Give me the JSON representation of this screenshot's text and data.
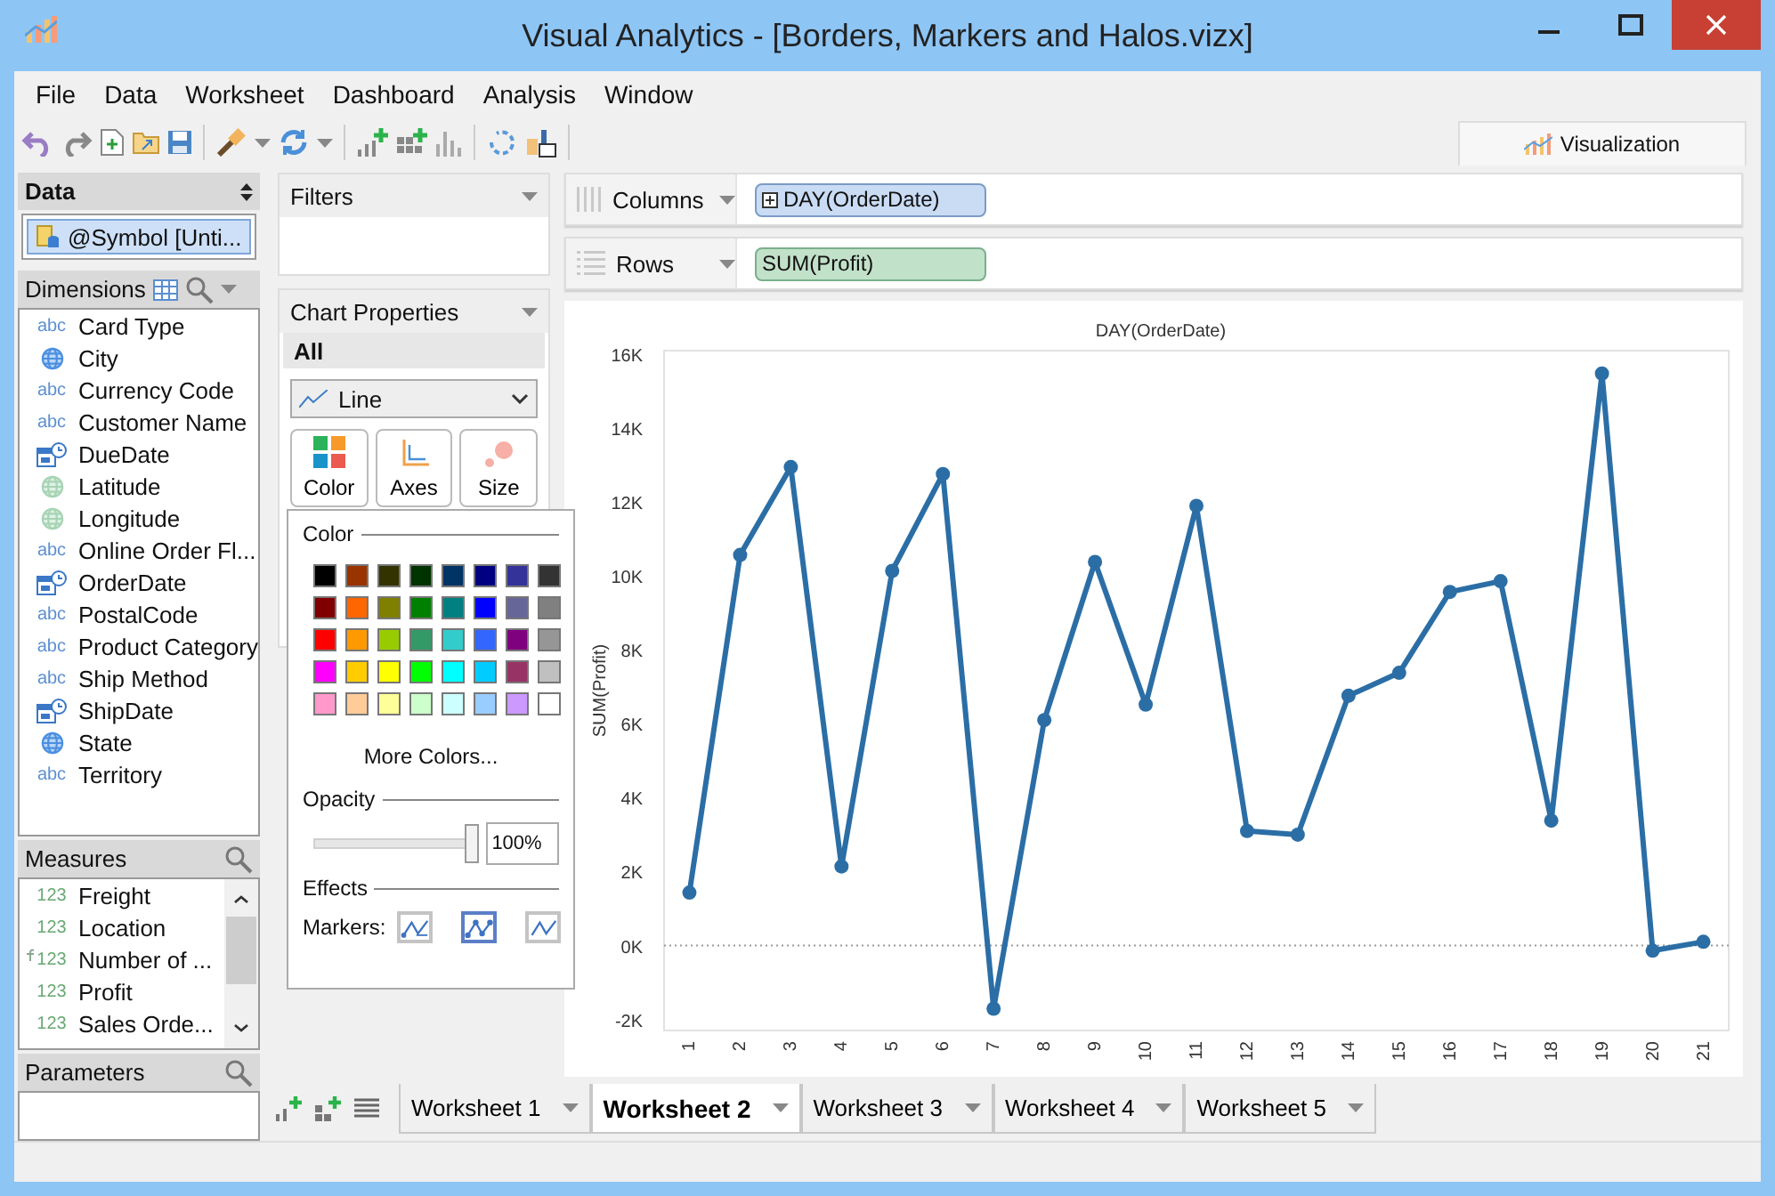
{
  "window": {
    "title": "Visual Analytics - [Borders, Markers and Halos.vizx]"
  },
  "menu": [
    "File",
    "Data",
    "Worksheet",
    "Dashboard",
    "Analysis",
    "Window"
  ],
  "toolbar_tab": {
    "label": "Visualization"
  },
  "data_pane": {
    "title": "Data",
    "source": "@Symbol [Unti..."
  },
  "dimensions": {
    "title": "Dimensions",
    "items": [
      {
        "kind": "string",
        "badge": "abc",
        "name": "Card Type"
      },
      {
        "kind": "geo",
        "name": "City"
      },
      {
        "kind": "string",
        "badge": "abc",
        "name": "Currency Code"
      },
      {
        "kind": "string",
        "badge": "abc",
        "name": "Customer Name"
      },
      {
        "kind": "date",
        "name": "DueDate"
      },
      {
        "kind": "geo_pale",
        "name": "Latitude"
      },
      {
        "kind": "geo_pale",
        "name": "Longitude"
      },
      {
        "kind": "string",
        "badge": "abc",
        "name": "Online Order Fl..."
      },
      {
        "kind": "date",
        "name": "OrderDate"
      },
      {
        "kind": "string",
        "badge": "abc",
        "name": "PostalCode"
      },
      {
        "kind": "string",
        "badge": "abc",
        "name": "Product Category"
      },
      {
        "kind": "string",
        "badge": "abc",
        "name": "Ship Method"
      },
      {
        "kind": "date",
        "name": "ShipDate"
      },
      {
        "kind": "geo",
        "name": "State"
      },
      {
        "kind": "string",
        "badge": "abc",
        "name": "Territory"
      }
    ]
  },
  "measures": {
    "title": "Measures",
    "items": [
      {
        "kind": "number",
        "badge": "123",
        "name": "Freight"
      },
      {
        "kind": "number",
        "badge": "123",
        "name": "Location"
      },
      {
        "kind": "calculated",
        "badge": "123",
        "name": "Number of ..."
      },
      {
        "kind": "number",
        "badge": "123",
        "name": "Profit"
      },
      {
        "kind": "number",
        "badge": "123",
        "name": "Sales Orde..."
      }
    ]
  },
  "parameters": {
    "title": "Parameters"
  },
  "filters": {
    "title": "Filters"
  },
  "chart_properties": {
    "title": "Chart Properties",
    "scope": "All",
    "mark_type": "Line",
    "buttons": [
      {
        "kind": "color",
        "label": "Color"
      },
      {
        "kind": "axes",
        "label": "Axes"
      },
      {
        "kind": "size",
        "label": "Size"
      }
    ]
  },
  "color_panel": {
    "title": "Color",
    "swatches": [
      {
        "color": "#000000"
      },
      {
        "color": "#993300"
      },
      {
        "color": "#333300"
      },
      {
        "color": "#003300"
      },
      {
        "color": "#003366"
      },
      {
        "color": "#000080"
      },
      {
        "color": "#333399"
      },
      {
        "color": "#333333"
      },
      {
        "color": "#800000"
      },
      {
        "color": "#ff6600"
      },
      {
        "color": "#808000"
      },
      {
        "color": "#008000"
      },
      {
        "color": "#008080"
      },
      {
        "color": "#0000ff"
      },
      {
        "color": "#666699"
      },
      {
        "color": "#808080"
      },
      {
        "color": "#ff0000"
      },
      {
        "color": "#ff9900"
      },
      {
        "color": "#99cc00"
      },
      {
        "color": "#339966"
      },
      {
        "color": "#33cccc"
      },
      {
        "color": "#3366ff"
      },
      {
        "color": "#800080"
      },
      {
        "color": "#969696"
      },
      {
        "color": "#ff00ff"
      },
      {
        "color": "#ffcc00"
      },
      {
        "color": "#ffff00"
      },
      {
        "color": "#00ff00"
      },
      {
        "color": "#00ffff"
      },
      {
        "color": "#00ccff"
      },
      {
        "color": "#993366"
      },
      {
        "color": "#c0c0c0"
      },
      {
        "color": "#ff99cc"
      },
      {
        "color": "#ffcc99"
      },
      {
        "color": "#ffff99"
      },
      {
        "color": "#ccffcc"
      },
      {
        "color": "#ccffff"
      },
      {
        "color": "#99ccff"
      },
      {
        "color": "#cc99ff"
      },
      {
        "color": "#ffffff"
      }
    ],
    "more_colors": "More Colors...",
    "opacity": {
      "label": "Opacity",
      "level": 1,
      "value": "100%"
    },
    "effects": {
      "title": "Effects",
      "markers_label": "Markers:",
      "options": [
        {
          "kind": "ends",
          "selected": false
        },
        {
          "kind": "all",
          "selected": true
        },
        {
          "kind": "none",
          "selected": false
        }
      ]
    }
  },
  "shelves": [
    {
      "kind": "columns",
      "label": "Columns",
      "pill": "DAY(OrderDate)"
    },
    {
      "kind": "rows",
      "label": "Rows",
      "pill": "SUM(Profit)"
    }
  ],
  "chart": {
    "chart_data": {
      "type": "line",
      "title": "DAY(OrderDate)",
      "ylabel": "SUM(Profit)",
      "categories": [
        "1",
        "2",
        "3",
        "4",
        "5",
        "6",
        "7",
        "8",
        "9",
        "10",
        "11",
        "12",
        "13",
        "14",
        "15",
        "16",
        "17",
        "18",
        "19",
        "20",
        "21"
      ],
      "series": [
        {
          "color": "#2b6ea6",
          "marker": "circle",
          "values": [
            1430,
            10570,
            12950,
            2140,
            10140,
            12760,
            -1710,
            6100,
            10380,
            6520,
            11900,
            3100,
            3000,
            6760,
            7380,
            9570,
            9860,
            3380,
            15480,
            -140,
            100
          ]
        }
      ],
      "ylim": [
        -2300,
        16100
      ],
      "yticks": [
        {
          "value": -2000,
          "label": "-2K"
        },
        {
          "value": 0,
          "label": "0K"
        },
        {
          "value": 2000,
          "label": "2K"
        },
        {
          "value": 4000,
          "label": "4K"
        },
        {
          "value": 6000,
          "label": "6K"
        },
        {
          "value": 8000,
          "label": "8K"
        },
        {
          "value": 10000,
          "label": "10K"
        },
        {
          "value": 12000,
          "label": "12K"
        },
        {
          "value": 14000,
          "label": "14K"
        },
        {
          "value": 16000,
          "label": "16K"
        }
      ]
    }
  },
  "sheet_tabs": [
    {
      "label": "Worksheet 1",
      "selected": false
    },
    {
      "label": "Worksheet 2",
      "selected": true
    },
    {
      "label": "Worksheet 3",
      "selected": false
    },
    {
      "label": "Worksheet 4",
      "selected": false
    },
    {
      "label": "Worksheet 5",
      "selected": false
    }
  ]
}
